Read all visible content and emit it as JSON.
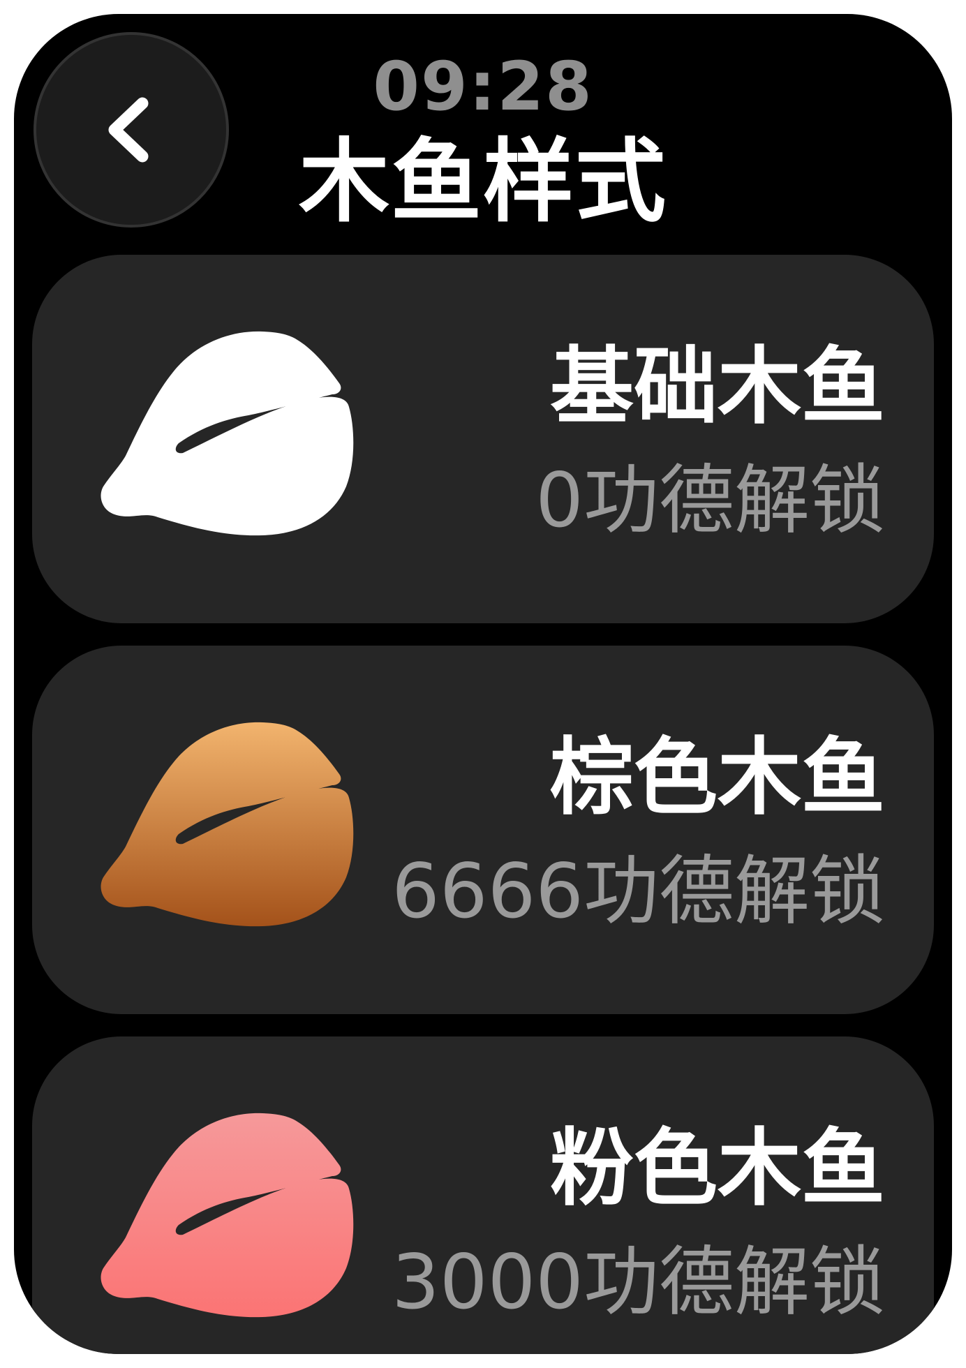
{
  "status": {
    "time": "09:28"
  },
  "header": {
    "title": "木鱼样式",
    "back_icon": "chevron-left-icon"
  },
  "styles": [
    {
      "name": "基础木鱼",
      "unlock": "0功德解锁",
      "icon": "wooden-fish-icon",
      "color_top": "#ffffff",
      "color_bottom": "#ffffff"
    },
    {
      "name": "棕色木鱼",
      "unlock": "6666功德解锁",
      "icon": "wooden-fish-icon",
      "color_top": "#f2b46e",
      "color_bottom": "#a4521a"
    },
    {
      "name": "粉色木鱼",
      "unlock": "3000功德解锁",
      "icon": "wooden-fish-icon",
      "color_top": "#f6999a",
      "color_bottom": "#fb7474"
    }
  ]
}
